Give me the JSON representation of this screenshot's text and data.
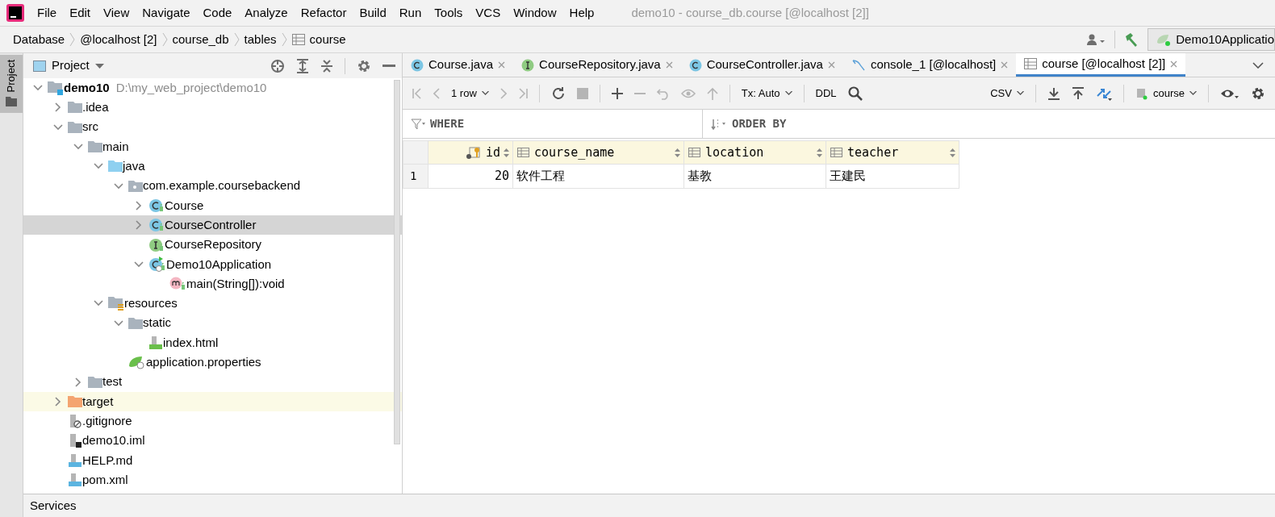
{
  "menu": [
    "File",
    "Edit",
    "View",
    "Navigate",
    "Code",
    "Analyze",
    "Refactor",
    "Build",
    "Run",
    "Tools",
    "VCS",
    "Window",
    "Help"
  ],
  "window": {
    "title": "demo10 - course_db.course [@localhost [2]]"
  },
  "breadcrumb": [
    {
      "label": "Database",
      "kind": "text"
    },
    {
      "label": "@localhost [2]",
      "kind": "text"
    },
    {
      "label": "course_db",
      "kind": "text"
    },
    {
      "label": "tables",
      "kind": "text"
    },
    {
      "label": "course",
      "kind": "table"
    }
  ],
  "run_config": "Demo10Applicatio",
  "side_tab": "Project",
  "project_panel": {
    "title": "Project"
  },
  "tree": [
    {
      "label": "demo10",
      "path": "D:\\my_web_project\\demo10",
      "kind": "module",
      "expanded": true,
      "selected": false,
      "children": [
        {
          "label": ".idea",
          "kind": "folder",
          "expanded": false,
          "selected": false
        },
        {
          "label": "src",
          "kind": "folder",
          "expanded": true,
          "selected": false,
          "children": [
            {
              "label": "main",
              "kind": "folder",
              "expanded": true,
              "selected": false,
              "children": [
                {
                  "label": "java",
                  "kind": "source-folder",
                  "expanded": true,
                  "selected": false,
                  "children": [
                    {
                      "label": "com.example.coursebackend",
                      "kind": "package",
                      "expanded": true,
                      "selected": false,
                      "children": [
                        {
                          "label": "Course",
                          "kind": "class",
                          "expanded": false,
                          "selected": false
                        },
                        {
                          "label": "CourseController",
                          "kind": "class",
                          "expanded": false,
                          "selected": true
                        },
                        {
                          "label": "CourseRepository",
                          "kind": "interface",
                          "selected": false
                        },
                        {
                          "label": "Demo10Application",
                          "kind": "app-class",
                          "expanded": true,
                          "selected": false,
                          "children": [
                            {
                              "label": "main(String[]):void",
                              "kind": "method",
                              "selected": false
                            }
                          ]
                        }
                      ]
                    }
                  ]
                },
                {
                  "label": "resources",
                  "kind": "resources-folder",
                  "expanded": true,
                  "selected": false,
                  "children": [
                    {
                      "label": "static",
                      "kind": "folder",
                      "expanded": true,
                      "selected": false,
                      "children": [
                        {
                          "label": "index.html",
                          "kind": "html",
                          "selected": false
                        }
                      ]
                    },
                    {
                      "label": "application.properties",
                      "kind": "properties",
                      "selected": false
                    }
                  ]
                }
              ]
            },
            {
              "label": "test",
              "kind": "folder",
              "expanded": false,
              "selected": false
            }
          ]
        },
        {
          "label": "target",
          "kind": "excluded-folder",
          "expanded": false,
          "selected": false
        },
        {
          "label": ".gitignore",
          "kind": "ignore-file",
          "selected": false
        },
        {
          "label": "demo10.iml",
          "kind": "iml",
          "selected": false
        },
        {
          "label": "HELP.md",
          "kind": "markdown",
          "selected": false
        },
        {
          "label": "pom.xml",
          "kind": "maven",
          "selected": false
        }
      ]
    }
  ],
  "tabs": [
    {
      "label": "Course.java",
      "kind": "class",
      "selected": false
    },
    {
      "label": "CourseRepository.java",
      "kind": "interface",
      "selected": false
    },
    {
      "label": "CourseController.java",
      "kind": "class",
      "selected": false
    },
    {
      "label": "console_1 [@localhost]",
      "kind": "console",
      "selected": false
    },
    {
      "label": "course [@localhost [2]]",
      "kind": "table",
      "selected": true
    }
  ],
  "toolbar": {
    "rows": "1 row",
    "tx": "Tx: Auto",
    "ddl": "DDL",
    "format": "CSV",
    "schema": "course"
  },
  "filter": {
    "where": "WHERE",
    "order_by": "ORDER BY"
  },
  "table": {
    "columns": [
      {
        "label": "id",
        "kind": "key"
      },
      {
        "label": "course_name",
        "kind": "column"
      },
      {
        "label": "location",
        "kind": "column"
      },
      {
        "label": "teacher",
        "kind": "column"
      }
    ],
    "rows": [
      {
        "number": "1",
        "cells": [
          "20",
          "软件工程",
          "基教",
          "王建民"
        ]
      }
    ]
  },
  "status_bar": "Services"
}
